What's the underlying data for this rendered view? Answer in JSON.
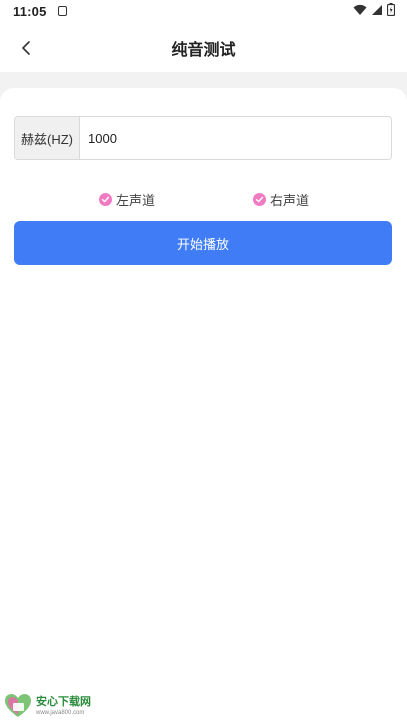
{
  "status_bar": {
    "time": "11:05",
    "icons": [
      "notification-icon",
      "wifi-icon",
      "signal-icon",
      "battery-icon"
    ]
  },
  "header": {
    "title": "纯音测试",
    "back_icon": "chevron-left-icon"
  },
  "form": {
    "frequency_label": "赫兹(HZ)",
    "frequency_value": "1000"
  },
  "channels": [
    {
      "label": "左声道",
      "checked": true
    },
    {
      "label": "右声道",
      "checked": true
    }
  ],
  "play_button": {
    "label": "开始播放"
  },
  "watermark": {
    "logo_text": "安心下载网",
    "url": "www.java800.com"
  },
  "colors": {
    "accent": "#3f7cf5",
    "check": "#f07bc3",
    "band": "#f2f2f2"
  }
}
